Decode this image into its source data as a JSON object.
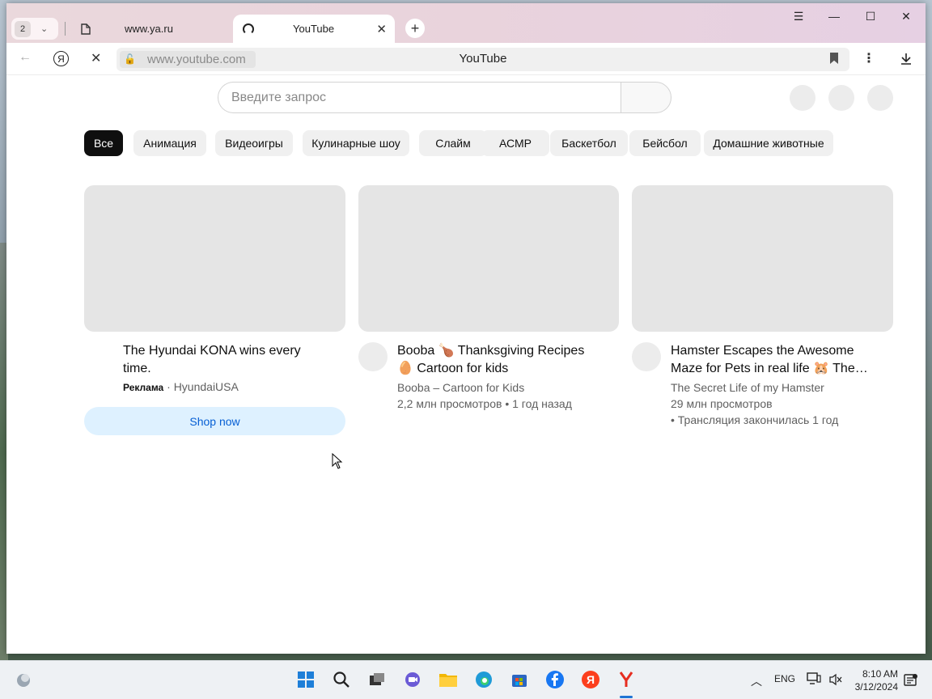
{
  "browser": {
    "tab_count": "2",
    "tabs": [
      {
        "label": "www.ya.ru"
      },
      {
        "label": "YouTube"
      }
    ],
    "address": {
      "url": "www.youtube.com",
      "page_title": "YouTube",
      "yandex_letter": "Я"
    }
  },
  "youtube": {
    "search_placeholder": "Введите запрос",
    "chips": [
      "Все",
      "Анимация",
      "Видеоигры",
      "Кулинарные шоу",
      "Слайм",
      "АСМР",
      "Баскетбол",
      "Бейсбол",
      "Домашние животные"
    ],
    "ad": {
      "title_line1": "The Hyundai KONA wins every",
      "title_line2": "time.",
      "ad_label": "Реклама",
      "advertiser": "HyundaiUSA",
      "cta": "Shop now"
    },
    "videos": [
      {
        "title_line1": "Booba 🍗 Thanksgiving Recipes",
        "title_line2": "🥚 Cartoon for kids",
        "channel": "Booba – Cartoon for Kids",
        "stats": "2,2 млн просмотров • 1 год назад"
      },
      {
        "title_line1": "Hamster Escapes the Awesome",
        "title_line2": "Maze for Pets in real life 🐹 The…",
        "channel": "The Secret Life of my Hamster",
        "stats": "29 млн просмотров",
        "stats2": "• Трансляция закончилась 1 год"
      }
    ]
  },
  "taskbar": {
    "language": "ENG",
    "time": "8:10 AM",
    "date": "3/12/2024",
    "yandex_letter": "Я"
  }
}
